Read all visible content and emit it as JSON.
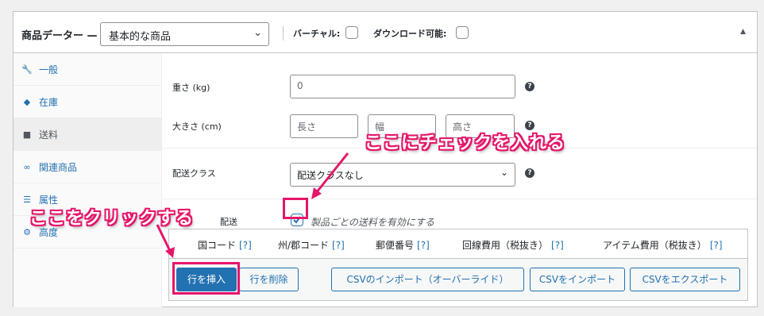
{
  "header": {
    "title": "商品データー —",
    "product_type": "基本的な商品",
    "virtual_label": "バーチャル:",
    "downloadable_label": "ダウンロード可能:"
  },
  "tabs": [
    {
      "label": "一般",
      "icon": "wrench-icon"
    },
    {
      "label": "在庫",
      "icon": "tag-icon"
    },
    {
      "label": "送料",
      "icon": "truck-icon"
    },
    {
      "label": "関連商品",
      "icon": "link-icon"
    },
    {
      "label": "属性",
      "icon": "list-icon"
    },
    {
      "label": "高度",
      "icon": "gear-icon"
    }
  ],
  "shipping": {
    "weight_label": "重さ (kg)",
    "weight_placeholder": "0",
    "dimensions_label": "大きさ (cm)",
    "length_placeholder": "長さ",
    "width_placeholder": "幅",
    "height_placeholder": "高さ",
    "class_label": "配送クラス",
    "class_value": "配送クラスなし",
    "per_product_label": "配送",
    "per_product_checkbox_label": "製品ごとの送料を有効にする",
    "per_product_checked": true
  },
  "rate_table": {
    "columns": [
      {
        "label": "国コード",
        "help": "[?]"
      },
      {
        "label": "州/郡コード",
        "help": "[?]"
      },
      {
        "label": "郵便番号",
        "help": "[?]"
      },
      {
        "label": "回線費用（税抜き）",
        "help": "[?]"
      },
      {
        "label": "アイテム費用（税抜き）",
        "help": "[?]"
      }
    ],
    "buttons": {
      "insert_row": "行を挿入",
      "delete_row": "行を削除",
      "import_override": "CSVのインポート（オーバーライド）",
      "import": "CSVをインポート",
      "export": "CSVをエクスポート"
    }
  },
  "annotations": {
    "check_here": "ここにチェックを入れる",
    "click_here": "ここをクリックする",
    "color": "#e6156a"
  }
}
